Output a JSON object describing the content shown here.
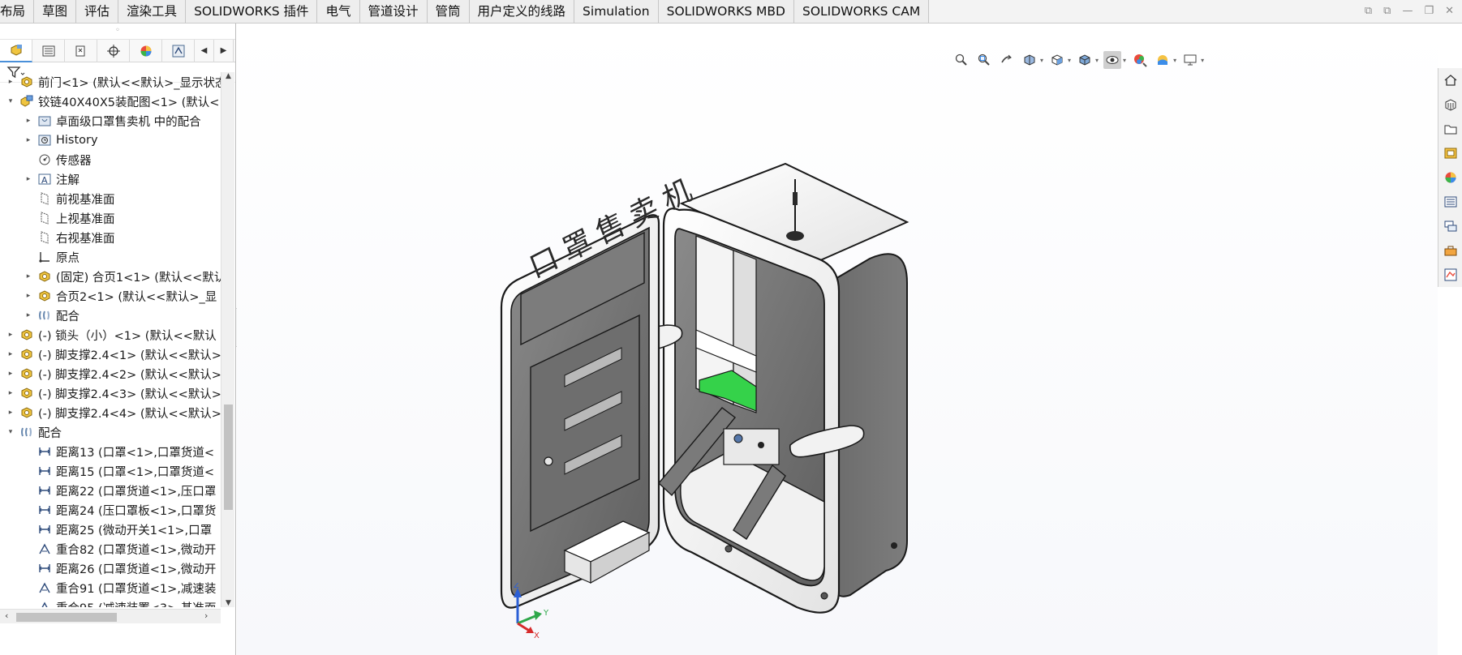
{
  "tabs": [
    "布局",
    "草图",
    "评估",
    "渲染工具",
    "SOLIDWORKS 插件",
    "电气",
    "管道设计",
    "管筒",
    "用户定义的线路",
    "Simulation",
    "SOLIDWORKS MBD",
    "SOLIDWORKS CAM"
  ],
  "panel_tabs": [
    "featuremanager-icon",
    "propertymanager-icon",
    "configurationmanager-icon",
    "dimxpert-icon",
    "display-manager-icon",
    "cam-manager-icon"
  ],
  "tree": [
    {
      "level": 0,
      "expand": "▸",
      "icon": "part-icon",
      "label": "前门<1> (默认<<默认>_显示状态"
    },
    {
      "level": 0,
      "expand": "▾",
      "icon": "subassembly-icon",
      "label": "铰链40X40X5装配图<1> (默认<"
    },
    {
      "level": 1,
      "expand": "▸",
      "icon": "mate-folder-icon",
      "label": "卓面级口罩售卖机 中的配合"
    },
    {
      "level": 1,
      "expand": "▸",
      "icon": "history-icon",
      "label": "History"
    },
    {
      "level": 1,
      "expand": "",
      "icon": "sensor-icon",
      "label": "传感器"
    },
    {
      "level": 1,
      "expand": "▸",
      "icon": "annotation-icon",
      "label": "注解"
    },
    {
      "level": 1,
      "expand": "",
      "icon": "plane-icon",
      "label": "前视基准面"
    },
    {
      "level": 1,
      "expand": "",
      "icon": "plane-icon",
      "label": "上视基准面"
    },
    {
      "level": 1,
      "expand": "",
      "icon": "plane-icon",
      "label": "右视基准面"
    },
    {
      "level": 1,
      "expand": "",
      "icon": "origin-icon",
      "label": "原点"
    },
    {
      "level": 1,
      "expand": "▸",
      "icon": "part-icon",
      "label": "(固定) 合页1<1> (默认<<默认"
    },
    {
      "level": 1,
      "expand": "▸",
      "icon": "part-icon",
      "label": "合页2<1> (默认<<默认>_显"
    },
    {
      "level": 1,
      "expand": "▸",
      "icon": "mates-icon",
      "label": "配合"
    },
    {
      "level": 0,
      "expand": "▸",
      "icon": "part-icon",
      "label": "(-) 锁头（小）<1> (默认<<默认"
    },
    {
      "level": 0,
      "expand": "▸",
      "icon": "part-icon",
      "label": "(-) 脚支撑2.4<1> (默认<<默认>"
    },
    {
      "level": 0,
      "expand": "▸",
      "icon": "part-icon",
      "label": "(-) 脚支撑2.4<2> (默认<<默认>"
    },
    {
      "level": 0,
      "expand": "▸",
      "icon": "part-icon",
      "label": "(-) 脚支撑2.4<3> (默认<<默认>"
    },
    {
      "level": 0,
      "expand": "▸",
      "icon": "part-icon",
      "label": "(-) 脚支撑2.4<4> (默认<<默认>"
    },
    {
      "level": 0,
      "expand": "▾",
      "icon": "mates-icon",
      "label": "配合"
    },
    {
      "level": 1,
      "expand": "",
      "icon": "distance-mate-icon",
      "label": "距离13 (口罩<1>,口罩货道<"
    },
    {
      "level": 1,
      "expand": "",
      "icon": "distance-mate-icon",
      "label": "距离15 (口罩<1>,口罩货道<"
    },
    {
      "level": 1,
      "expand": "",
      "icon": "distance-mate-icon",
      "label": "距离22 (口罩货道<1>,压口罩"
    },
    {
      "level": 1,
      "expand": "",
      "icon": "distance-mate-icon",
      "label": "距离24 (压口罩板<1>,口罩货"
    },
    {
      "level": 1,
      "expand": "",
      "icon": "distance-mate-icon",
      "label": "距离25 (微动开关1<1>,口罩"
    },
    {
      "level": 1,
      "expand": "",
      "icon": "coincident-mate-icon",
      "label": "重合82 (口罩货道<1>,微动开"
    },
    {
      "level": 1,
      "expand": "",
      "icon": "distance-mate-icon",
      "label": "距离26 (口罩货道<1>,微动开"
    },
    {
      "level": 1,
      "expand": "",
      "icon": "coincident-mate-icon",
      "label": "重合91 (口罩货道<1>,减速装"
    },
    {
      "level": 1,
      "expand": "",
      "icon": "coincident-mate-icon",
      "label": "重合95 (减速装置<3>,基准面"
    }
  ],
  "heads_up": [
    "zoom-to-fit-icon",
    "zoom-to-area-icon",
    "previous-view-icon",
    "section-view-icon",
    "view-orientation-icon",
    "display-style-icon",
    "hide-show-items-icon",
    "edit-appearance-icon",
    "apply-scene-icon",
    "view-settings-icon"
  ],
  "task_pane": [
    "solidworks-resources-icon",
    "design-library-icon",
    "file-explorer-icon",
    "view-palette-icon",
    "appearances-icon",
    "custom-properties-icon",
    "forum-icon",
    "toolbox-icon",
    "3d-content-icon"
  ],
  "model_label": "口罩售卖机",
  "triad": {
    "x": "X",
    "y": "Y",
    "z": "Z"
  },
  "colors": {
    "accent": "#4a90d9",
    "model_body": "#707070",
    "model_edge": "#1a1a1a",
    "green_part": "#35d24a",
    "triad_x": "#d62b2b",
    "triad_y": "#2fa84a",
    "triad_z": "#2b5fd6"
  }
}
